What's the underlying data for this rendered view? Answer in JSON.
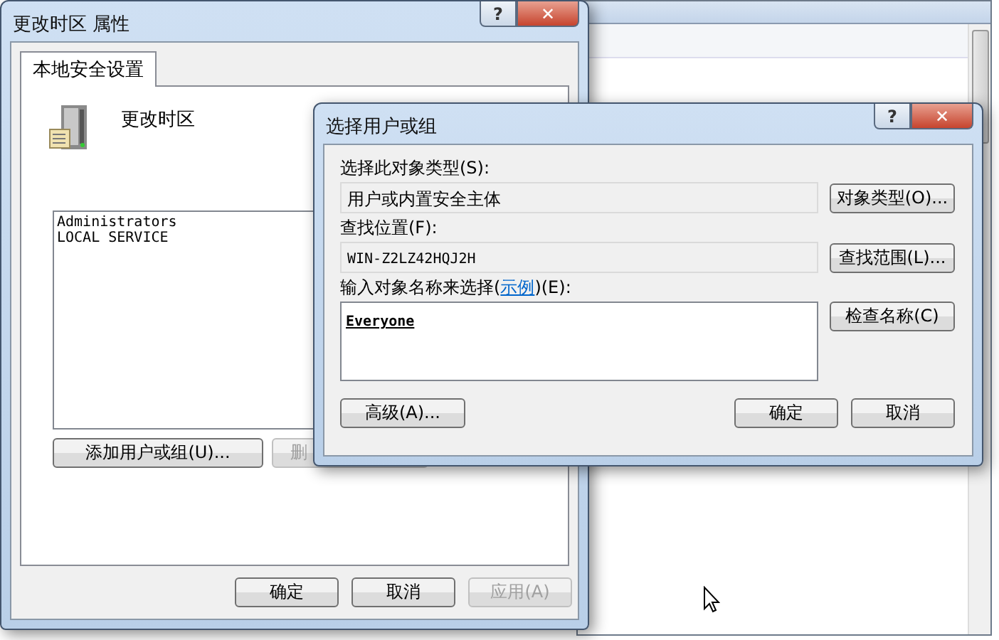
{
  "properties_dialog": {
    "title": "更改时区 属性",
    "caption_buttons": [
      "?",
      "✕"
    ],
    "tabs": [
      {
        "label": "本地安全设置",
        "selected": true
      }
    ],
    "policy_name": "更改时区",
    "members": [
      "Administrators",
      "LOCAL SERVICE"
    ],
    "list_buttons": [
      {
        "label": "添加用户或组(U)...",
        "disabled": false
      },
      {
        "label": "删",
        "disabled": true
      }
    ],
    "footer_buttons": [
      {
        "label": "确定",
        "disabled": false
      },
      {
        "label": "取消",
        "disabled": false
      },
      {
        "label": "应用(A)",
        "disabled": true
      }
    ]
  },
  "select_dialog": {
    "title": "选择用户或组",
    "caption_buttons": [
      "?",
      "✕"
    ],
    "object_type_label": "选择此对象类型(S):",
    "object_type": "用户或内置安全主体",
    "object_type_button": "对象类型(O)...",
    "location_label": "查找位置(F):",
    "location": "WIN-Z2LZ42HQJ2H",
    "location_button": "查找范围(L)...",
    "names_label_before": "输入对象名称来选择(",
    "names_label_link": "示例",
    "names_label_after": ")(E):",
    "names_value": "Everyone",
    "check_names_button": "检查名称(C)",
    "advanced_button": "高级(A)...",
    "ok_button": "确定",
    "cancel_button": "取消"
  }
}
